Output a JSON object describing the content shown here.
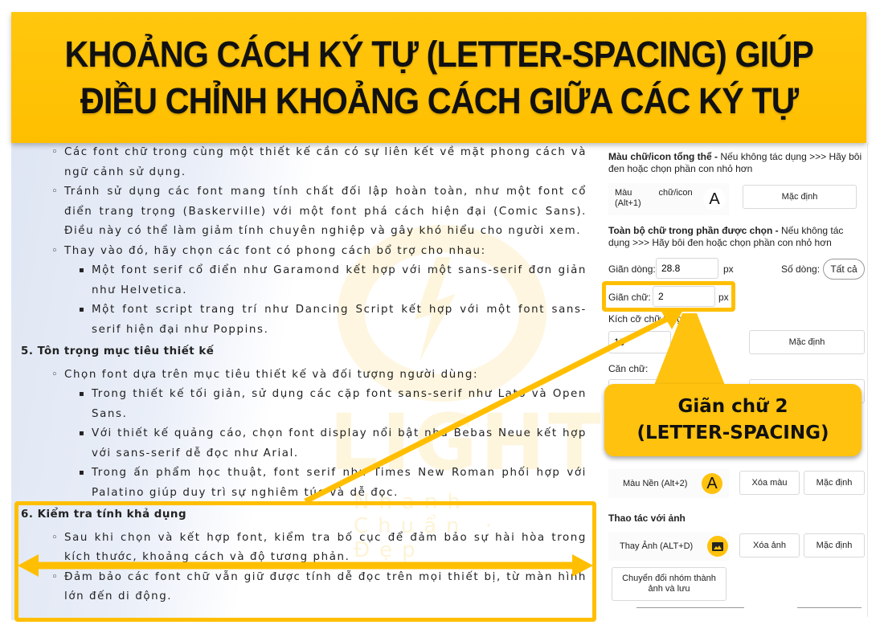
{
  "banner": {
    "line1": "KHOẢNG CÁCH KÝ TỰ (LETTER-SPACING) GIÚP",
    "line2": "ĐIỀU CHỈNH KHOẢNG CÁCH GIỮA CÁC KÝ TỰ"
  },
  "watermark": {
    "brand": "LIGHT",
    "slogan": "Nhanh · Chuẩn · Đẹp"
  },
  "document": {
    "items": [
      {
        "level": 1,
        "text": "Các font chữ trong cùng một thiết kế cần có sự liên kết về mặt phong cách và ngữ cảnh sử dụng."
      },
      {
        "level": 1,
        "text": "Tránh sử dụng các font mang tính chất đối lập hoàn toàn, như một font cổ điển trang trọng (Baskerville) với một font phá cách hiện đại (Comic Sans). Điều này có thể làm giảm tính chuyên nghiệp và gây khó hiểu cho người xem."
      },
      {
        "level": 1,
        "text": "Thay vào đó, hãy chọn các font có phong cách bổ trợ cho nhau:"
      },
      {
        "level": 2,
        "text": "Một font serif cổ điển như Garamond kết hợp với một sans-serif đơn giản như Helvetica."
      },
      {
        "level": 2,
        "text": "Một font script trang trí như Dancing Script kết hợp với một font sans-serif hiện đại như Poppins."
      },
      {
        "level": 0,
        "text": "5. Tôn trọng mục tiêu thiết kế"
      },
      {
        "level": 1,
        "text": "Chọn font dựa trên mục tiêu thiết kế và đối tượng người dùng:"
      },
      {
        "level": 2,
        "text": "Trong thiết kế tối giản, sử dụng các cặp font sans-serif như Lato và Open Sans."
      },
      {
        "level": 2,
        "text": "Với thiết kế quảng cáo, chọn font display nổi bật như Bebas Neue kết hợp với sans-serif dễ đọc như Arial."
      },
      {
        "level": 2,
        "text": "Trong ấn phẩm học thuật, font serif như Times New Roman phối hợp với Palatino giúp duy trì sự nghiêm túc và dễ đọc."
      },
      {
        "level": 0,
        "text": "6. Kiểm tra tính khả dụng"
      },
      {
        "level": 1,
        "text": "Sau khi chọn và kết hợp font, kiểm tra bố cục để đảm bảo sự hài hòa trong kích thước, khoảng cách và độ tương phản."
      },
      {
        "level": 1,
        "text": "Đảm bảo các font chữ vẫn giữ được tính dễ đọc trên mọi thiết bị, từ màn hình lớn đến di động."
      }
    ]
  },
  "panel": {
    "text_color_section": {
      "title": "Màu chữ/icon tổng thể -",
      "hint": " Nếu không tác dụng >>> Hãy bôi đen hoặc chọn phần con nhỏ hơn",
      "color_label": "Màu chữ/icon (Alt+1)",
      "color_icon": "A",
      "default_button": "Mặc định"
    },
    "selected_text_section": {
      "title": "Toàn bộ chữ trong phần được chọn -",
      "hint": " Nếu không tác dụng >>> Hãy bôi đen hoặc chọn phần con nhỏ hơn",
      "line_height_label": "Giãn dòng:",
      "line_height_value": "28.8",
      "line_height_unit": "px",
      "line_count_label": "Số dòng:",
      "line_count_button": "Tất cả",
      "letter_spacing_label": "Giãn chữ:",
      "letter_spacing_value": "2",
      "letter_spacing_unit": "px",
      "font_size_label": "Kích cỡ chữ tổng:",
      "font_size_value": "10",
      "font_size_default_button": "Mặc định",
      "align_label": "Căn chữ:"
    },
    "background_section": {
      "bg_color_label": "Màu Nền (Alt+2)",
      "bg_color_icon": "A",
      "clear_color_button": "Xóa màu",
      "default_button": "Mặc định"
    },
    "image_section": {
      "title": "Thao tác với ảnh",
      "replace_image_label": "Thay Ảnh (ALT+D)",
      "clear_image_button": "Xóa ảnh",
      "default_button": "Mặc định",
      "convert_group_button": "Chuyển đổi nhóm thành ảnh và lưu"
    }
  },
  "callout": {
    "line1": "Giãn chữ 2",
    "line2": "(LETTER-SPACING)"
  },
  "colors": {
    "accent": "#ffbf00",
    "banner": "#ffc20e"
  }
}
